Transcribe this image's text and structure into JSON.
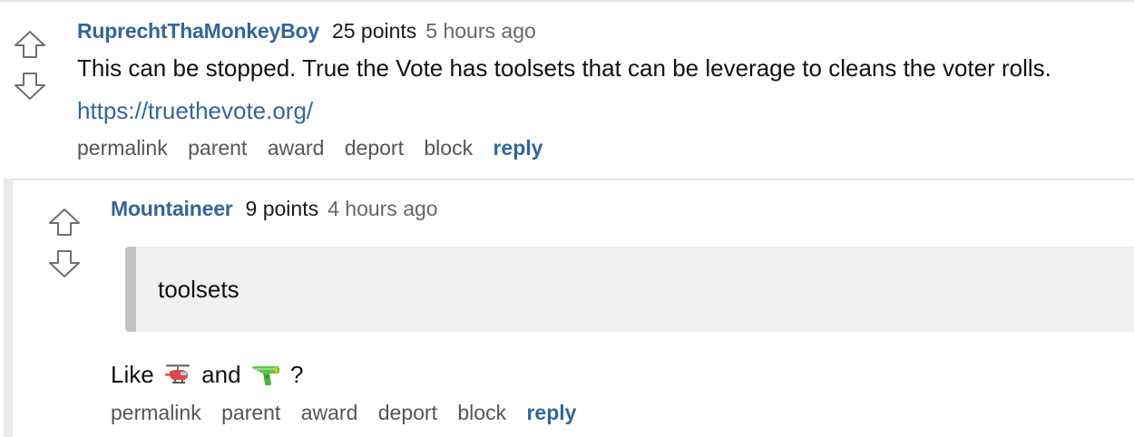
{
  "comments": [
    {
      "author": "RuprechtThaMonkeyBoy",
      "points": "25 points",
      "time": "5 hours ago",
      "body": "This can be stopped. True the Vote has toolsets that can be leverage to cleans the voter rolls.",
      "link": "https://truethevote.org/",
      "actions": [
        "permalink",
        "parent",
        "award",
        "deport",
        "block",
        "reply"
      ]
    },
    {
      "author": "Mountaineer",
      "points": "9 points",
      "time": "4 hours ago",
      "quote": "toolsets",
      "body_before": "Like",
      "emoji_1": "helicopter-emoji",
      "body_middle": "and",
      "emoji_2": "water-pistol-emoji",
      "body_after": "?",
      "actions": [
        "permalink",
        "parent",
        "award",
        "deport",
        "block",
        "reply"
      ]
    }
  ],
  "colors": {
    "author": "#336699",
    "reply": "#336699",
    "action": "#555555",
    "quote_bg": "#f0f0f0",
    "quote_border": "#c4c4c4"
  }
}
